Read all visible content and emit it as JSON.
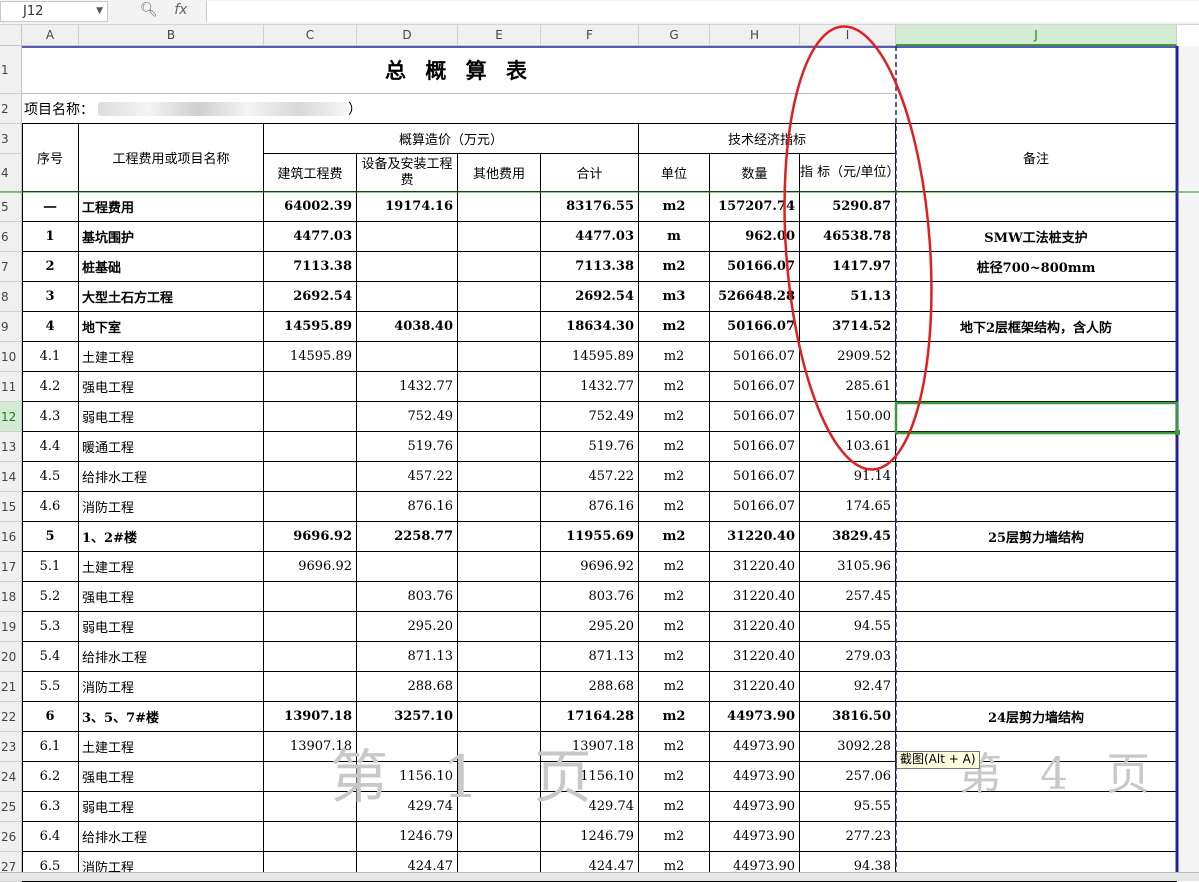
{
  "namebox": "J12",
  "fx_label": "fx",
  "columns": [
    "A",
    "B",
    "C",
    "D",
    "E",
    "F",
    "G",
    "H",
    "I",
    "J"
  ],
  "selected_col": "J",
  "selected_row": 12,
  "row_numbers": [
    1,
    2,
    3,
    4,
    5,
    6,
    7,
    8,
    9,
    10,
    11,
    12,
    13,
    14,
    15,
    16,
    17,
    18,
    19,
    20,
    21,
    22,
    23,
    24,
    25,
    26,
    27
  ],
  "title": "总 概 算 表",
  "project_label": "项目名称：",
  "project_tail": "）",
  "headers": {
    "seq": "序号",
    "name": "工程费用或项目名称",
    "estimate_group": "概算造价（万元）",
    "building": "建筑工程费",
    "equipment": "设备及安装工程费",
    "other": "其他费用",
    "total": "合计",
    "tech_group": "技术经济指标",
    "unit": "单位",
    "quantity": "数量",
    "index": "指 标（元/单位）",
    "remark": "备注"
  },
  "rows": [
    {
      "seq": "一",
      "name": "工程费用",
      "c": "64002.39",
      "d": "19174.16",
      "e": "",
      "f": "83176.55",
      "unit": "m2",
      "qty": "157207.74",
      "idx": "5290.87",
      "remark": "",
      "bold": true
    },
    {
      "seq": "1",
      "name": "基坑围护",
      "c": "4477.03",
      "d": "",
      "e": "",
      "f": "4477.03",
      "unit": "m",
      "qty": "962.00",
      "idx": "46538.78",
      "remark": "SMW工法桩支护",
      "bold": true
    },
    {
      "seq": "2",
      "name": "桩基础",
      "c": "7113.38",
      "d": "",
      "e": "",
      "f": "7113.38",
      "unit": "m2",
      "qty": "50166.07",
      "idx": "1417.97",
      "remark": "桩径700~800mm",
      "bold": true
    },
    {
      "seq": "3",
      "name": "大型土石方工程",
      "c": "2692.54",
      "d": "",
      "e": "",
      "f": "2692.54",
      "unit": "m3",
      "qty": "526648.28",
      "idx": "51.13",
      "remark": "",
      "bold": true
    },
    {
      "seq": "4",
      "name": "地下室",
      "c": "14595.89",
      "d": "4038.40",
      "e": "",
      "f": "18634.30",
      "unit": "m2",
      "qty": "50166.07",
      "idx": "3714.52",
      "remark": "地下2层框架结构，含人防",
      "bold": true
    },
    {
      "seq": "4.1",
      "name": "土建工程",
      "c": "14595.89",
      "d": "",
      "e": "",
      "f": "14595.89",
      "unit": "m2",
      "qty": "50166.07",
      "idx": "2909.52",
      "remark": "",
      "bold": false
    },
    {
      "seq": "4.2",
      "name": "强电工程",
      "c": "",
      "d": "1432.77",
      "e": "",
      "f": "1432.77",
      "unit": "m2",
      "qty": "50166.07",
      "idx": "285.61",
      "remark": "",
      "bold": false
    },
    {
      "seq": "4.3",
      "name": "弱电工程",
      "c": "",
      "d": "752.49",
      "e": "",
      "f": "752.49",
      "unit": "m2",
      "qty": "50166.07",
      "idx": "150.00",
      "remark": "",
      "bold": false
    },
    {
      "seq": "4.4",
      "name": "暖通工程",
      "c": "",
      "d": "519.76",
      "e": "",
      "f": "519.76",
      "unit": "m2",
      "qty": "50166.07",
      "idx": "103.61",
      "remark": "",
      "bold": false
    },
    {
      "seq": "4.5",
      "name": "给排水工程",
      "c": "",
      "d": "457.22",
      "e": "",
      "f": "457.22",
      "unit": "m2",
      "qty": "50166.07",
      "idx": "91.14",
      "remark": "",
      "bold": false
    },
    {
      "seq": "4.6",
      "name": "消防工程",
      "c": "",
      "d": "876.16",
      "e": "",
      "f": "876.16",
      "unit": "m2",
      "qty": "50166.07",
      "idx": "174.65",
      "remark": "",
      "bold": false
    },
    {
      "seq": "5",
      "name": "1、2#楼",
      "c": "9696.92",
      "d": "2258.77",
      "e": "",
      "f": "11955.69",
      "unit": "m2",
      "qty": "31220.40",
      "idx": "3829.45",
      "remark": "25层剪力墙结构",
      "bold": true
    },
    {
      "seq": "5.1",
      "name": "土建工程",
      "c": "9696.92",
      "d": "",
      "e": "",
      "f": "9696.92",
      "unit": "m2",
      "qty": "31220.40",
      "idx": "3105.96",
      "remark": "",
      "bold": false
    },
    {
      "seq": "5.2",
      "name": "强电工程",
      "c": "",
      "d": "803.76",
      "e": "",
      "f": "803.76",
      "unit": "m2",
      "qty": "31220.40",
      "idx": "257.45",
      "remark": "",
      "bold": false
    },
    {
      "seq": "5.3",
      "name": "弱电工程",
      "c": "",
      "d": "295.20",
      "e": "",
      "f": "295.20",
      "unit": "m2",
      "qty": "31220.40",
      "idx": "94.55",
      "remark": "",
      "bold": false
    },
    {
      "seq": "5.4",
      "name": "给排水工程",
      "c": "",
      "d": "871.13",
      "e": "",
      "f": "871.13",
      "unit": "m2",
      "qty": "31220.40",
      "idx": "279.03",
      "remark": "",
      "bold": false
    },
    {
      "seq": "5.5",
      "name": "消防工程",
      "c": "",
      "d": "288.68",
      "e": "",
      "f": "288.68",
      "unit": "m2",
      "qty": "31220.40",
      "idx": "92.47",
      "remark": "",
      "bold": false
    },
    {
      "seq": "6",
      "name": "3、5、7#楼",
      "c": "13907.18",
      "d": "3257.10",
      "e": "",
      "f": "17164.28",
      "unit": "m2",
      "qty": "44973.90",
      "idx": "3816.50",
      "remark": "24层剪力墙结构",
      "bold": true
    },
    {
      "seq": "6.1",
      "name": "土建工程",
      "c": "13907.18",
      "d": "",
      "e": "",
      "f": "13907.18",
      "unit": "m2",
      "qty": "44973.90",
      "idx": "3092.28",
      "remark": "",
      "bold": false
    },
    {
      "seq": "6.2",
      "name": "强电工程",
      "c": "",
      "d": "1156.10",
      "e": "",
      "f": "1156.10",
      "unit": "m2",
      "qty": "44973.90",
      "idx": "257.06",
      "remark": "",
      "bold": false
    },
    {
      "seq": "6.3",
      "name": "弱电工程",
      "c": "",
      "d": "429.74",
      "e": "",
      "f": "429.74",
      "unit": "m2",
      "qty": "44973.90",
      "idx": "95.55",
      "remark": "",
      "bold": false
    },
    {
      "seq": "6.4",
      "name": "给排水工程",
      "c": "",
      "d": "1246.79",
      "e": "",
      "f": "1246.79",
      "unit": "m2",
      "qty": "44973.90",
      "idx": "277.23",
      "remark": "",
      "bold": false
    },
    {
      "seq": "6.5",
      "name": "消防工程",
      "c": "",
      "d": "424.47",
      "e": "",
      "f": "424.47",
      "unit": "m2",
      "qty": "44973.90",
      "idx": "94.38",
      "remark": "",
      "bold": false
    }
  ],
  "watermark_left": "第 1 页",
  "watermark_right": "第 4 页",
  "tooltip": "截图(Alt + A)",
  "colors": {
    "selection": "#3c9a3c",
    "page_break": "#2b2b8c",
    "annotation": "#e02020"
  }
}
